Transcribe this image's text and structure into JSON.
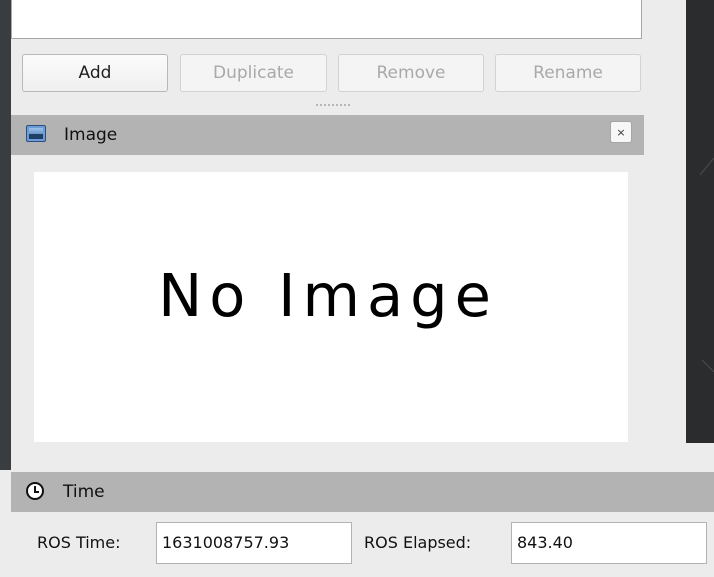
{
  "buttons": {
    "add": "Add",
    "duplicate": "Duplicate",
    "remove": "Remove",
    "rename": "Rename"
  },
  "image_panel": {
    "title": "Image",
    "close_glyph": "×",
    "placeholder": "No Image",
    "icon": "image-icon"
  },
  "time_panel": {
    "title": "Time",
    "icon": "clock-icon",
    "ros_time_label": "ROS Time:",
    "ros_time_value": "1631008757.93",
    "ros_elapsed_label": "ROS Elapsed:",
    "ros_elapsed_value": "843.40"
  },
  "colors": {
    "window_bg": "#ececec",
    "panel_title_bg": "#b3b3b3",
    "dark_viewport": "#2a2c2e"
  }
}
